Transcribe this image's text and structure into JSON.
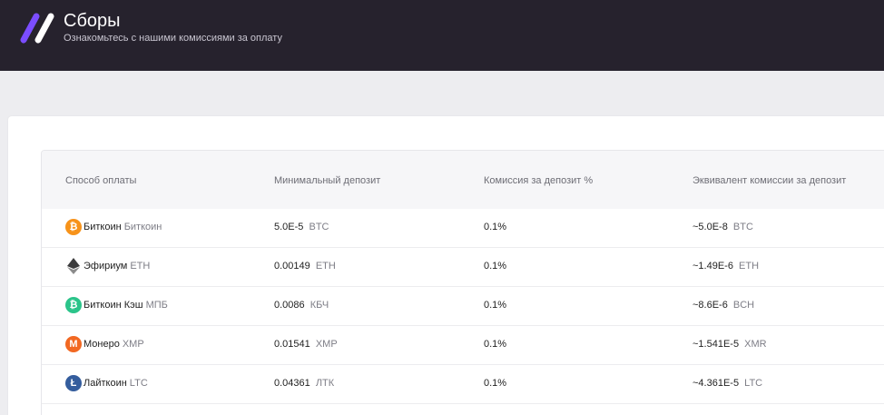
{
  "header": {
    "title": "Сборы",
    "subtitle": "Ознакомьтесь с нашими комиссиями за оплату"
  },
  "table": {
    "columns": [
      "Способ оплаты",
      "Минимальный депозит",
      "Комиссия за депозит %",
      "Эквивалент комиссии за депозит"
    ],
    "rows": [
      {
        "name": "Биткоин",
        "code": "Биткоин",
        "icon": "bitcoin-icon",
        "icon_color": "#f7931a",
        "glyph": "₿",
        "min": "5.0E-5",
        "min_unit": "BTC",
        "fee": "0.1%",
        "eq": "~5.0E-8",
        "eq_unit": "BTC"
      },
      {
        "name": "Эфириум",
        "code": "ETH",
        "icon": "ethereum-icon",
        "icon_color": "#3c3c3d",
        "glyph": "◆",
        "min": "0.00149",
        "min_unit": "ETH",
        "fee": "0.1%",
        "eq": "~1.49E-6",
        "eq_unit": "ETH"
      },
      {
        "name": "Биткоин Кэш",
        "code": "МПБ",
        "icon": "bitcoin-cash-icon",
        "icon_color": "#2bc48a",
        "glyph": "₿",
        "min": "0.0086",
        "min_unit": "КБЧ",
        "fee": "0.1%",
        "eq": "~8.6E-6",
        "eq_unit": "BCH"
      },
      {
        "name": "Монеро",
        "code": "XMP",
        "icon": "monero-icon",
        "icon_color": "#f26822",
        "glyph": "M",
        "min": "0.01541",
        "min_unit": "XMP",
        "fee": "0.1%",
        "eq": "~1.541E-5",
        "eq_unit": "XMR"
      },
      {
        "name": "Лайткоин",
        "code": "LTC",
        "icon": "litecoin-icon",
        "icon_color": "#345d9d",
        "glyph": "Ł",
        "min": "0.04361",
        "min_unit": "ЛТК",
        "fee": "0.1%",
        "eq": "~4.361E-5",
        "eq_unit": "LTC"
      }
    ]
  },
  "colors": {
    "header_bg": "#26222d",
    "logo_purple": "#7b4dff",
    "logo_white": "#ffffff"
  }
}
